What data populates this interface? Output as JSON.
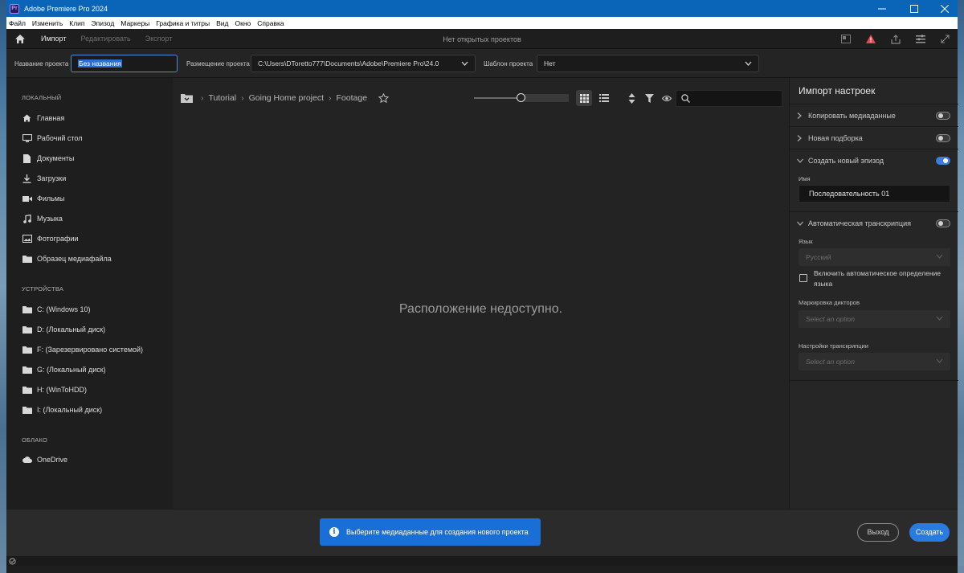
{
  "window": {
    "title": "Adobe Premiere Pro 2024",
    "logo_text": "Pr"
  },
  "menu": [
    "Файл",
    "Изменить",
    "Клип",
    "Эпизод",
    "Маркеры",
    "Графика и титры",
    "Вид",
    "Окно",
    "Справка"
  ],
  "header": {
    "tabs": {
      "import": "Импорт",
      "edit": "Редактировать",
      "export": "Экспорт"
    },
    "title": "Нет открытых проектов"
  },
  "project": {
    "name_label": "Название проекта",
    "name_value": "Без названия",
    "location_label": "Размещение проекта",
    "location_value": "C:\\Users\\DToretto777\\Documents\\Adobe\\Premiere Pro\\24.0",
    "template_label": "Шаблон проекта",
    "template_value": "Нет"
  },
  "sidebar": {
    "local_header": "ЛОКАЛЬНЫЙ",
    "local_items": [
      "Главная",
      "Рабочий стол",
      "Документы",
      "Загрузки",
      "Фильмы",
      "Музыка",
      "Фотографии",
      "Образец медиафайла"
    ],
    "devices_header": "УСТРОЙСТВА",
    "devices": [
      "C: (Windows 10)",
      "D: (Локальный диск)",
      "F: (Зарезервировано системой)",
      "G: (Локальный диск)",
      "H: (WinToHDD)",
      "I: (Локальный диск)"
    ],
    "cloud_header": "ОБЛАКО",
    "cloud_items": [
      "OneDrive"
    ]
  },
  "browser": {
    "breadcrumb": [
      "Tutorial",
      "Going Home project",
      "Footage"
    ],
    "thumbnail_size_fraction": 0.5,
    "search_placeholder": "",
    "empty_message": "Расположение недоступно."
  },
  "settings": {
    "title": "Импорт настроек",
    "copy_media": {
      "label": "Копировать медиаданные",
      "on": false
    },
    "new_bin": {
      "label": "Новая подборка",
      "on": false
    },
    "new_sequence": {
      "label": "Создать новый эпизод",
      "on": true
    },
    "name_label": "Имя",
    "name_value": "Последовательность 01",
    "auto_transcribe": {
      "label": "Автоматическая транскрипция",
      "on": false
    },
    "language_label": "Язык",
    "language_value": "Русский",
    "auto_detect_label": "Включить автоматическое определение языка",
    "speaker_label": "Маркировка дикторов",
    "speaker_value": "Select an option",
    "transcription_settings_label": "Настройки транскрипции",
    "transcription_settings_value": "Select an option"
  },
  "footer": {
    "toast": "Выберите медиаданные для создания нового проекта",
    "exit": "Выход",
    "create": "Создать"
  },
  "colors": {
    "accent": "#2a7be0",
    "titlebar": "#0a64b8",
    "warning": "#e34850"
  }
}
